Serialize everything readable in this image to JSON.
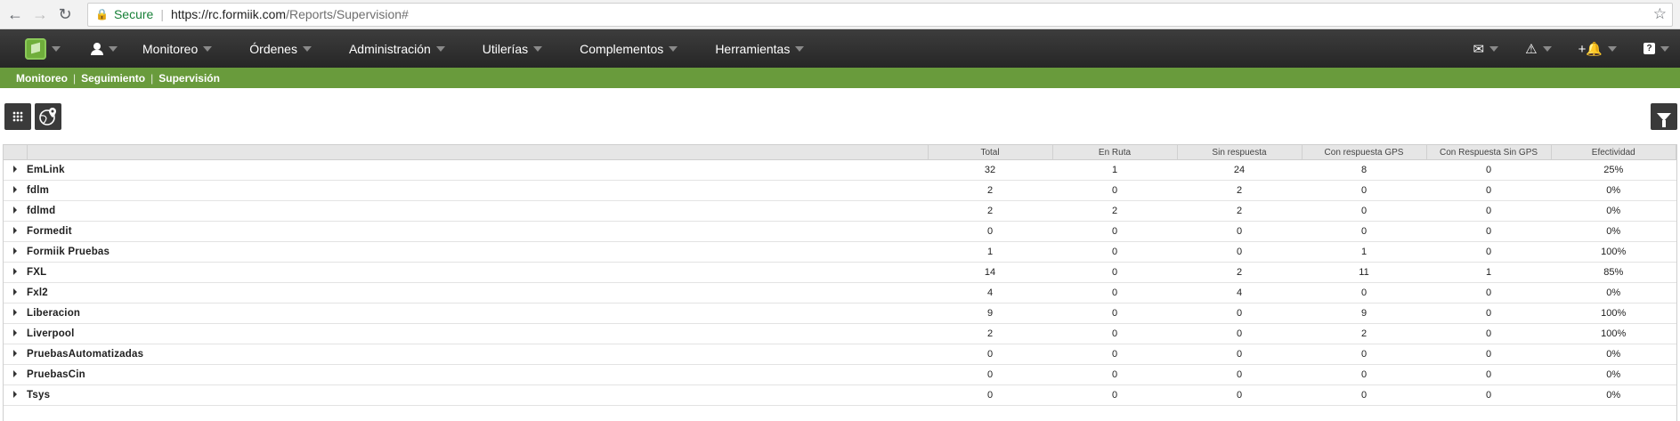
{
  "browser": {
    "secure_label": "Secure",
    "url_host": "https://rc.formiik.com",
    "url_path": "/Reports/Supervision#"
  },
  "nav": {
    "menu": [
      "Monitoreo",
      "Órdenes",
      "Administración",
      "Utilerías",
      "Complementos",
      "Herramientas"
    ]
  },
  "breadcrumb": [
    "Monitoreo",
    "Seguimiento",
    "Supervisión"
  ],
  "table": {
    "headers": [
      "Total",
      "En Ruta",
      "Sin respuesta",
      "Con respuesta GPS",
      "Con Respuesta Sin GPS",
      "Efectividad"
    ],
    "rows": [
      {
        "name": "EmLink",
        "values": [
          "32",
          "1",
          "24",
          "8",
          "0",
          "25%"
        ]
      },
      {
        "name": "fdlm",
        "values": [
          "2",
          "0",
          "2",
          "0",
          "0",
          "0%"
        ]
      },
      {
        "name": "fdlmd",
        "values": [
          "2",
          "2",
          "2",
          "0",
          "0",
          "0%"
        ]
      },
      {
        "name": "Formedit",
        "values": [
          "0",
          "0",
          "0",
          "0",
          "0",
          "0%"
        ]
      },
      {
        "name": "Formiik Pruebas",
        "values": [
          "1",
          "0",
          "0",
          "1",
          "0",
          "100%"
        ]
      },
      {
        "name": "FXL",
        "values": [
          "14",
          "0",
          "2",
          "11",
          "1",
          "85%"
        ]
      },
      {
        "name": "Fxl2",
        "values": [
          "4",
          "0",
          "4",
          "0",
          "0",
          "0%"
        ]
      },
      {
        "name": "Liberacion",
        "values": [
          "9",
          "0",
          "0",
          "9",
          "0",
          "100%"
        ]
      },
      {
        "name": "Liverpool",
        "values": [
          "2",
          "0",
          "0",
          "2",
          "0",
          "100%"
        ]
      },
      {
        "name": "PruebasAutomatizadas",
        "values": [
          "0",
          "0",
          "0",
          "0",
          "0",
          "0%"
        ]
      },
      {
        "name": "PruebasCin",
        "values": [
          "0",
          "0",
          "0",
          "0",
          "0",
          "0%"
        ]
      },
      {
        "name": "Tsys",
        "values": [
          "0",
          "0",
          "0",
          "0",
          "0",
          "0%"
        ]
      }
    ]
  },
  "colors": {
    "nav_bg": "#2b2b2b",
    "breadcrumb_bg": "#699b3c",
    "secure_green": "#188038"
  },
  "icons": [
    "back-icon",
    "forward-icon",
    "reload-icon",
    "lock-icon",
    "star-icon",
    "logo-icon",
    "user-icon",
    "mail-icon",
    "warning-icon",
    "bell-icon",
    "help-icon",
    "grid-icon",
    "map-pin-icon",
    "filter-icon",
    "expand-icon"
  ]
}
